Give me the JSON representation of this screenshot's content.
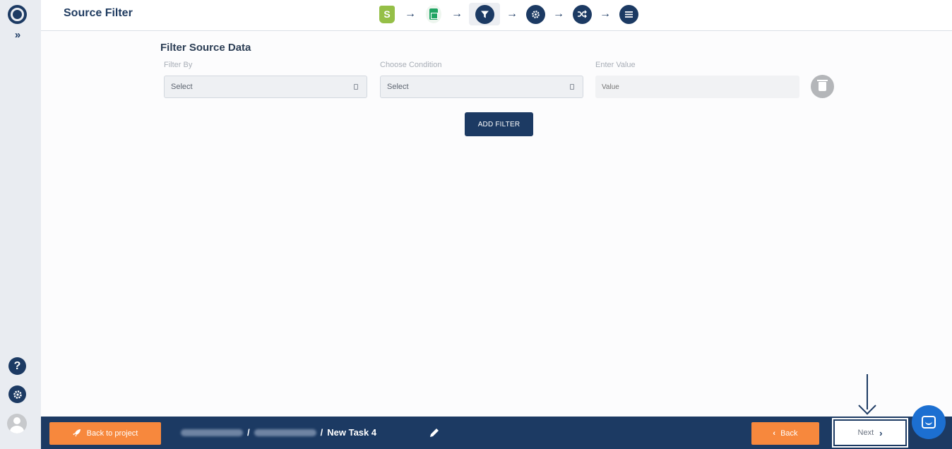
{
  "header": {
    "title": "Source Filter",
    "steps": [
      {
        "name": "shopify",
        "icon": "shopify-icon"
      },
      {
        "name": "google-sheets",
        "icon": "sheets-icon"
      },
      {
        "name": "filter",
        "icon": "filter-icon",
        "active": true
      },
      {
        "name": "settings",
        "icon": "gear-icon"
      },
      {
        "name": "mapping",
        "icon": "shuffle-icon"
      },
      {
        "name": "summary",
        "icon": "list-icon"
      }
    ]
  },
  "sidebar": {
    "expand_glyph": "»",
    "help_glyph": "?"
  },
  "main": {
    "section_title": "Filter Source Data",
    "filter_by_label": "Filter By",
    "filter_by_value": "Select",
    "condition_label": "Choose Condition",
    "condition_value": "Select",
    "value_label": "Enter Value",
    "value_placeholder": "Value",
    "add_filter_label": "ADD FILTER"
  },
  "footer": {
    "back_to_project_label": "Back to project",
    "crumb_sep": "/",
    "task_name": "New Task 4",
    "back_label": "Back",
    "next_label": "Next"
  },
  "colors": {
    "primary": "#1c3a63",
    "accent": "#f7883d",
    "chat": "#1c6fd1"
  }
}
